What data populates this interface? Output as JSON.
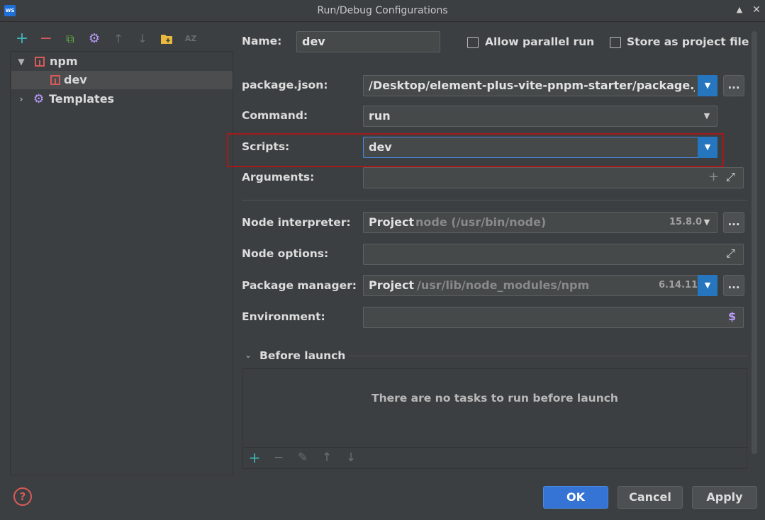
{
  "window": {
    "title": "Run/Debug Configurations",
    "app_icon_text": "WS"
  },
  "toolbar": {
    "add": "+",
    "remove": "−",
    "copy": "⧉",
    "settings": "⚙",
    "up": "↑",
    "down": "↓",
    "folder": "▬",
    "sort": "AZ"
  },
  "tree": {
    "npm_label": "npm",
    "dev_label": "dev",
    "templates_label": "Templates"
  },
  "form": {
    "name_label": "Name:",
    "name_value": "dev",
    "allow_parallel_label": "Allow parallel run",
    "store_project_label": "Store as project file",
    "package_json_label": "package.json:",
    "package_json_value": "/Desktop/element-plus-vite-pnpm-starter/package.json",
    "command_label": "Command:",
    "command_value": "run",
    "scripts_label": "Scripts:",
    "scripts_value": "dev",
    "arguments_label": "Arguments:",
    "arguments_value": "",
    "node_interpreter_label": "Node interpreter:",
    "node_interpreter_prefix": "Project",
    "node_interpreter_value": "node (/usr/bin/node)",
    "node_interpreter_version": "15.8.0",
    "node_options_label": "Node options:",
    "package_manager_label": "Package manager:",
    "package_manager_prefix": "Project",
    "package_manager_value": "/usr/lib/node_modules/npm",
    "package_manager_version": "6.14.11",
    "environment_label": "Environment:",
    "environment_icon": "$",
    "ellipsis": "..."
  },
  "before_launch": {
    "title": "Before launch",
    "empty_text": "There are no tasks to run before launch"
  },
  "buttons": {
    "ok": "OK",
    "cancel": "Cancel",
    "apply": "Apply",
    "help": "?"
  },
  "colors": {
    "accent": "#3574d4",
    "highlight_box": "#a41a1a",
    "npm_red": "#d75a5a"
  }
}
